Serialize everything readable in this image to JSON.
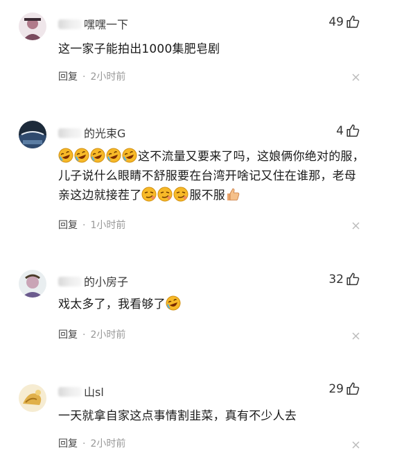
{
  "comments": [
    {
      "username_visible": "嘿嘿一下",
      "likes": "49",
      "text": "这一家子能拍出1000集肥皂剧",
      "reply_label": "回复",
      "dot": "·",
      "time": "2小时前"
    },
    {
      "username_visible": "的光束G",
      "likes": "4",
      "text_after_emojis": "这不流量又要来了吗，这娘俩你绝对的服，儿子说什么眼睛不舒服要在台湾开啥记又住在谁那，老母亲这边就接茬了",
      "text_tail": "服不服",
      "reply_label": "回复",
      "dot": "·",
      "time": "1小时前"
    },
    {
      "username_visible": "的小房子",
      "likes": "32",
      "text": "戏太多了，我看够了",
      "reply_label": "回复",
      "dot": "·",
      "time": "2小时前"
    },
    {
      "username_visible": "山sl",
      "likes": "29",
      "text": "一天就拿自家这点事情割韭菜，真有不少人去",
      "reply_label": "回复",
      "dot": "·",
      "time": "2小时前"
    }
  ],
  "icons": {
    "like": "thumbs-up-icon",
    "close": "close-icon",
    "laugh_emoji": "rofl-emoji",
    "smirk_emoji": "smirk-emoji",
    "thumbs_emoji": "thumbs-up-emoji"
  },
  "colors": {
    "text": "#1a1a1a",
    "meta": "#999999",
    "emoji_yellow": "#f7b928"
  }
}
